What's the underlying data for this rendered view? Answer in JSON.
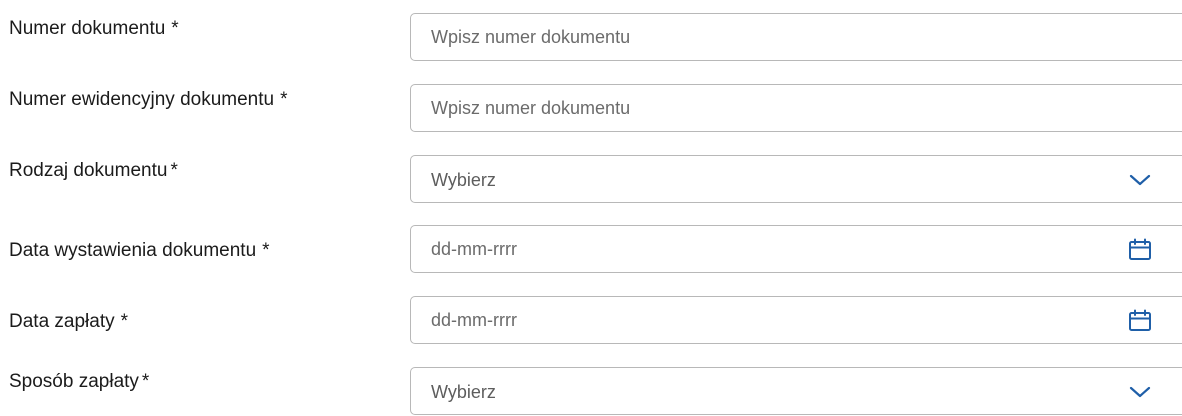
{
  "form": {
    "fields": [
      {
        "label": "Numer dokumentu",
        "required_mark": "*",
        "type": "text",
        "placeholder": "Wpisz numer dokumentu",
        "value": ""
      },
      {
        "label": "Numer ewidencyjny dokumentu",
        "required_mark": "*",
        "type": "text",
        "placeholder": "Wpisz numer dokumentu",
        "value": ""
      },
      {
        "label": "Rodzaj dokumentu",
        "required_mark": "*",
        "type": "select",
        "selected": "Wybierz",
        "icon": "chevron-down-icon"
      },
      {
        "label": "Data wystawienia dokumentu",
        "required_mark": "*",
        "type": "date",
        "placeholder": "dd-mm-rrrr",
        "value": "",
        "icon": "calendar-icon"
      },
      {
        "label": "Data zapłaty",
        "required_mark": "*",
        "type": "date",
        "placeholder": "dd-mm-rrrr",
        "value": "",
        "icon": "calendar-icon"
      },
      {
        "label": "Sposób zapłaty",
        "required_mark": "*",
        "type": "select",
        "selected": "Wybierz",
        "icon": "chevron-down-icon"
      }
    ]
  },
  "colors": {
    "text": "#1b1b1b",
    "placeholder": "#6b6b6b",
    "border": "#b8b8b8",
    "icon_accent": "#1f5fa8"
  }
}
